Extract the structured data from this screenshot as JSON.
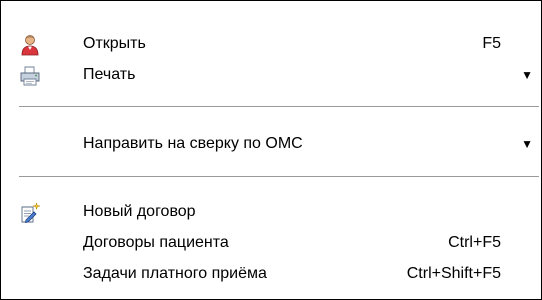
{
  "menu": {
    "items": [
      {
        "icon": "user-icon",
        "label": "Открыть",
        "shortcut": "F5",
        "has_submenu": false
      },
      {
        "icon": "printer-icon",
        "label": "Печать",
        "shortcut": "",
        "has_submenu": true
      },
      {
        "icon": "",
        "label": "Направить на сверку по ОМС",
        "shortcut": "",
        "has_submenu": true
      },
      {
        "icon": "new-document-icon",
        "label": "Новый договор",
        "shortcut": "",
        "has_submenu": false
      },
      {
        "icon": "",
        "label": "Договоры пациента",
        "shortcut": "Ctrl+F5",
        "has_submenu": false
      },
      {
        "icon": "",
        "label": "Задачи платного приёма",
        "shortcut": "Ctrl+Shift+F5",
        "has_submenu": false
      }
    ],
    "submenu_arrow": "▼"
  }
}
